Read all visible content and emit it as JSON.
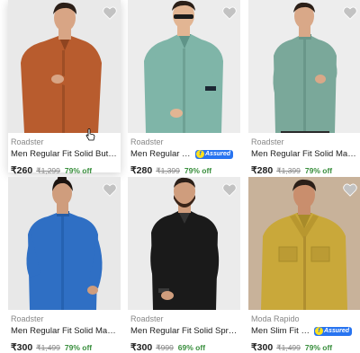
{
  "products": [
    {
      "brand": "Roadster",
      "title": "Men Regular Fit Solid Button Down Collar Casual Shirt",
      "assured": false,
      "price": "₹260",
      "mrp": "₹1,299",
      "discount": "79% off",
      "hovered": true
    },
    {
      "brand": "Roadster",
      "title": "Men Regular Fit Solid Casual Shirt",
      "assured": true,
      "assured_label": "Assured",
      "price": "₹280",
      "mrp": "₹1,399",
      "discount": "79% off",
      "hovered": false
    },
    {
      "brand": "Roadster",
      "title": "Men Regular Fit Solid Mandarin Collar Casual Shirt",
      "assured": false,
      "price": "₹280",
      "mrp": "₹1,399",
      "discount": "79% off",
      "hovered": false
    },
    {
      "brand": "Roadster",
      "title": "Men Regular Fit Solid Mandarin Collar Casual Shirt",
      "assured": false,
      "price": "₹300",
      "mrp": "₹1,499",
      "discount": "79% off",
      "hovered": false
    },
    {
      "brand": "Roadster",
      "title": "Men Regular Fit Solid Spread Collar Casual Shirt",
      "assured": false,
      "price": "₹300",
      "mrp": "₹999",
      "discount": "69% off",
      "hovered": false
    },
    {
      "brand": "Moda Rapido",
      "title": "Men Slim Fit Solid Casual Shirt",
      "assured": true,
      "assured_label": "Assured",
      "price": "₹300",
      "mrp": "₹1,499",
      "discount": "79% off",
      "hovered": false
    }
  ],
  "colors": {
    "price_green": "#388e3c",
    "assured_blue": "#2874f0",
    "shirts": [
      "#b85c2e",
      "#7fb5a8",
      "#7aa89a",
      "#2f6fc4",
      "#1a1a1a",
      "#c9a83a"
    ]
  }
}
